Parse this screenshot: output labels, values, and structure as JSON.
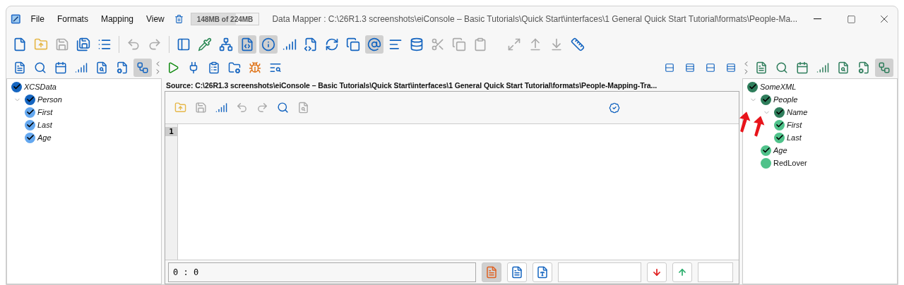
{
  "window": {
    "title": "Data Mapper : C:\\26R1.3 screenshots\\eiConsole – Basic Tutorials\\Quick Start\\interfaces\\1 General Quick Start Tutorial\\formats\\People-Ma..."
  },
  "menu": [
    "File",
    "Formats",
    "Mapping",
    "View"
  ],
  "memory": {
    "text": "148MB of 224MB",
    "level": 0.66
  },
  "main_toolbar": [
    {
      "kind": "button",
      "selected": false,
      "disabled": false
    },
    {
      "kind": "button",
      "selected": false,
      "disabled": false
    },
    {
      "kind": "button",
      "selected": false,
      "disabled": true
    },
    {
      "kind": "button",
      "selected": false,
      "disabled": false
    },
    {
      "kind": "button",
      "selected": false,
      "disabled": false
    },
    {
      "kind": "separator"
    },
    {
      "kind": "button",
      "selected": false,
      "disabled": true
    },
    {
      "kind": "button",
      "selected": false,
      "disabled": true
    },
    {
      "kind": "separator"
    },
    {
      "kind": "button",
      "selected": false,
      "disabled": false
    },
    {
      "kind": "button",
      "selected": false,
      "disabled": false
    },
    {
      "kind": "button",
      "selected": false,
      "disabled": false
    },
    {
      "kind": "button",
      "selected": true,
      "disabled": false
    },
    {
      "kind": "button",
      "selected": true,
      "disabled": false
    },
    {
      "kind": "button",
      "selected": false,
      "disabled": false
    },
    {
      "kind": "button",
      "selected": false,
      "disabled": false
    },
    {
      "kind": "button",
      "selected": false,
      "disabled": false
    },
    {
      "kind": "button",
      "selected": false,
      "disabled": false
    },
    {
      "kind": "button",
      "selected": true,
      "disabled": false
    },
    {
      "kind": "button",
      "selected": false,
      "disabled": false
    },
    {
      "kind": "button",
      "selected": false,
      "disabled": false
    },
    {
      "kind": "button",
      "selected": false,
      "disabled": true
    },
    {
      "kind": "button",
      "selected": false,
      "disabled": true
    },
    {
      "kind": "button",
      "selected": false,
      "disabled": true
    },
    {
      "kind": "gap"
    },
    {
      "kind": "button",
      "selected": false,
      "disabled": true
    },
    {
      "kind": "button",
      "selected": false,
      "disabled": true
    },
    {
      "kind": "button",
      "selected": false,
      "disabled": true
    },
    {
      "kind": "button",
      "selected": false,
      "disabled": false
    }
  ],
  "left_toolbar": [
    {
      "selected": false
    },
    {
      "selected": false
    },
    {
      "selected": false
    },
    {
      "selected": false
    },
    {
      "selected": false
    },
    {
      "selected": false
    },
    {
      "selected": true
    }
  ],
  "mapping_toolbar": [
    {
      "selected": false
    },
    {
      "selected": false
    },
    {
      "selected": false
    },
    {
      "selected": false
    },
    {
      "selected": false
    },
    {
      "selected": false
    }
  ],
  "layout_toolbar": [
    {
      "selected": false
    },
    {
      "selected": false
    },
    {
      "selected": false
    },
    {
      "selected": false
    }
  ],
  "right_toolbar": [
    {
      "selected": false
    },
    {
      "selected": false
    },
    {
      "selected": false
    },
    {
      "selected": false
    },
    {
      "selected": false
    },
    {
      "selected": false
    },
    {
      "selected": true
    }
  ],
  "source_tree": [
    {
      "label": "XCSData",
      "checked": true,
      "color": "#1565c0"
    },
    {
      "label": "Person",
      "checked": true,
      "color": "#1565c0",
      "expanded": true,
      "children": [
        {
          "label": "First",
          "checked": true,
          "color": "#64a8f0"
        },
        {
          "label": "Last",
          "checked": true,
          "color": "#64a8f0"
        },
        {
          "label": "Age",
          "checked": true,
          "color": "#64a8f0"
        }
      ]
    }
  ],
  "editor": {
    "title": "Source: C:\\26R1.3 screenshots\\eiConsole – Basic Tutorials\\Quick Start\\interfaces\\1 General Quick Start Tutorial\\formats\\People-Mapping-Tra...",
    "toolbar": [
      {
        "disabled": false
      },
      {
        "disabled": true
      },
      {
        "disabled": false
      },
      {
        "disabled": true
      },
      {
        "disabled": true
      },
      {
        "disabled": false
      },
      {
        "disabled": true
      }
    ],
    "line_numbers": [
      "1"
    ],
    "position": "0 : 0",
    "view_buttons": [
      {
        "selected": true
      },
      {
        "selected": false
      },
      {
        "selected": false
      }
    ]
  },
  "target_tree": [
    {
      "label": "SomeXML",
      "checked": true,
      "color": "#2e7d5b"
    },
    {
      "label": "People",
      "checked": true,
      "color": "#2e7d5b",
      "expanded": true,
      "children": [
        {
          "label": "Name",
          "checked": true,
          "color": "#2e7d5b",
          "expanded": true,
          "children": [
            {
              "label": "First",
              "checked": true,
              "color": "#4fc28a"
            },
            {
              "label": "Last",
              "checked": true,
              "color": "#4fc28a"
            }
          ]
        },
        {
          "label": "Age",
          "checked": true,
          "color": "#4fc28a"
        },
        {
          "label": "RedLover",
          "checked": false,
          "color": "#4fc28a"
        }
      ]
    }
  ]
}
